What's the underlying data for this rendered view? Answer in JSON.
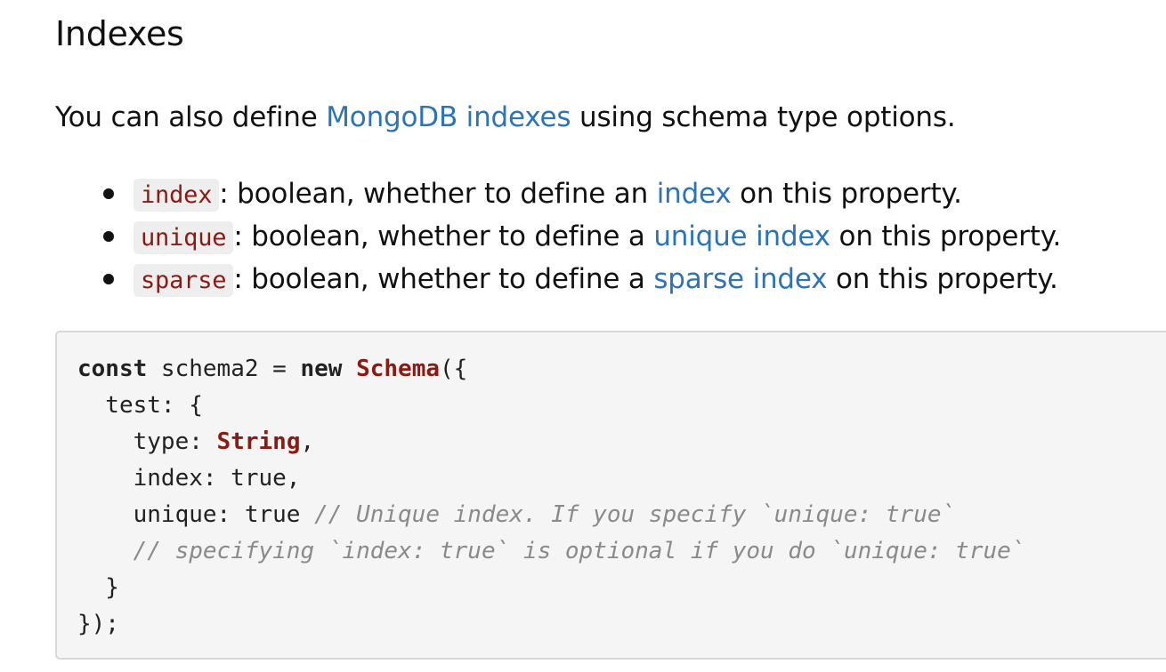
{
  "heading": "Indexes",
  "intro": {
    "before": "You can also define ",
    "link": "MongoDB indexes",
    "after": " using schema type options."
  },
  "options": [
    {
      "code": "index",
      "text_before": ": boolean, whether to define an ",
      "link": "index",
      "text_after": " on this property."
    },
    {
      "code": "unique",
      "text_before": ": boolean, whether to define a ",
      "link": "unique index",
      "text_after": " on this property."
    },
    {
      "code": "sparse",
      "text_before": ": boolean, whether to define a ",
      "link": "sparse index",
      "text_after": " on this property."
    }
  ],
  "code": {
    "l1_kw1": "const",
    "l1_a": " schema2 = ",
    "l1_kw2": "new",
    "l1_sp": " ",
    "l1_type": "Schema",
    "l1_b": "({",
    "l2": "  test: {",
    "l3_a": "    type: ",
    "l3_type": "String",
    "l3_b": ",",
    "l4": "    index: true,",
    "l5_a": "    unique: true ",
    "l5_comment": "// Unique index. If you specify `unique: true`",
    "l6_indent": "    ",
    "l6_comment": "// specifying `index: true` is optional if you do `unique: true`",
    "l7": "  }",
    "l8": "});"
  }
}
